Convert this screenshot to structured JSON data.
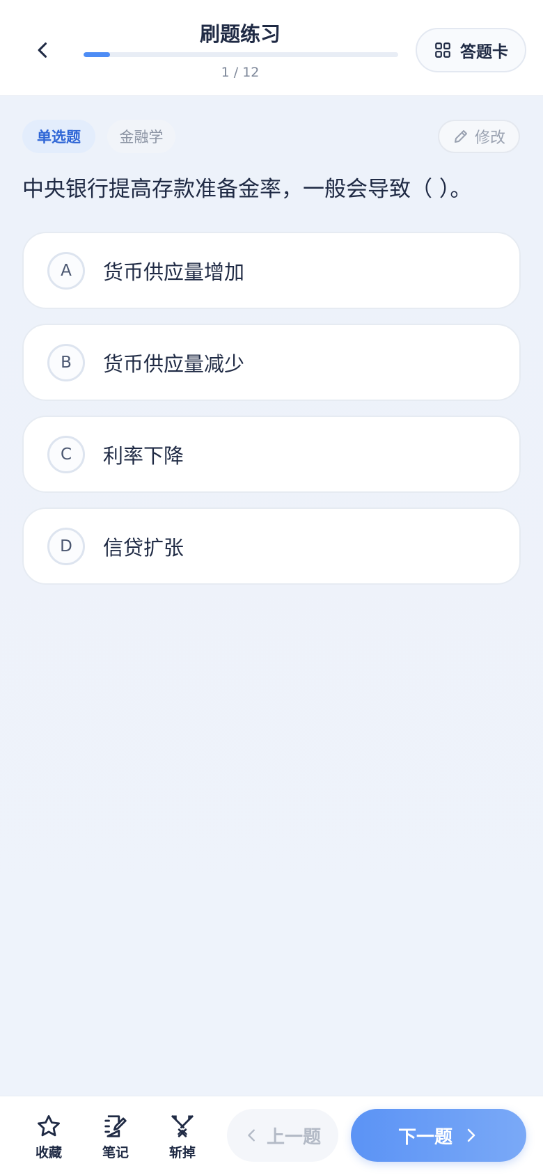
{
  "header": {
    "title": "刷题练习",
    "progress_text": "1 / 12",
    "progress_fraction": 0.0833,
    "answer_card_label": "答题卡"
  },
  "question": {
    "type_tag": "单选题",
    "subject_tag": "金融学",
    "edit_label": "修改",
    "text": "中央银行提高存款准备金率，一般会导致（ ）。",
    "options": [
      {
        "letter": "A",
        "text": "货币供应量增加"
      },
      {
        "letter": "B",
        "text": "货币供应量减少"
      },
      {
        "letter": "C",
        "text": "利率下降"
      },
      {
        "letter": "D",
        "text": "信贷扩张"
      }
    ]
  },
  "toolbar": {
    "favorite_label": "收藏",
    "note_label": "笔记",
    "cut_label": "斩掉",
    "prev_label": "上一题",
    "next_label": "下一题"
  },
  "colors": {
    "accent": "#4d8cf5",
    "text_primary": "#1f2a44",
    "text_muted": "#8b93a3",
    "tag_bg": "#e3edfc"
  },
  "icons": {
    "back": "chevron-left-icon",
    "answer_card": "grid-icon",
    "edit": "pencil-icon",
    "favorite": "star-icon",
    "note": "notebook-pen-icon",
    "cut": "crossed-swords-icon",
    "prev": "chevron-left-icon",
    "next": "chevron-right-icon"
  }
}
